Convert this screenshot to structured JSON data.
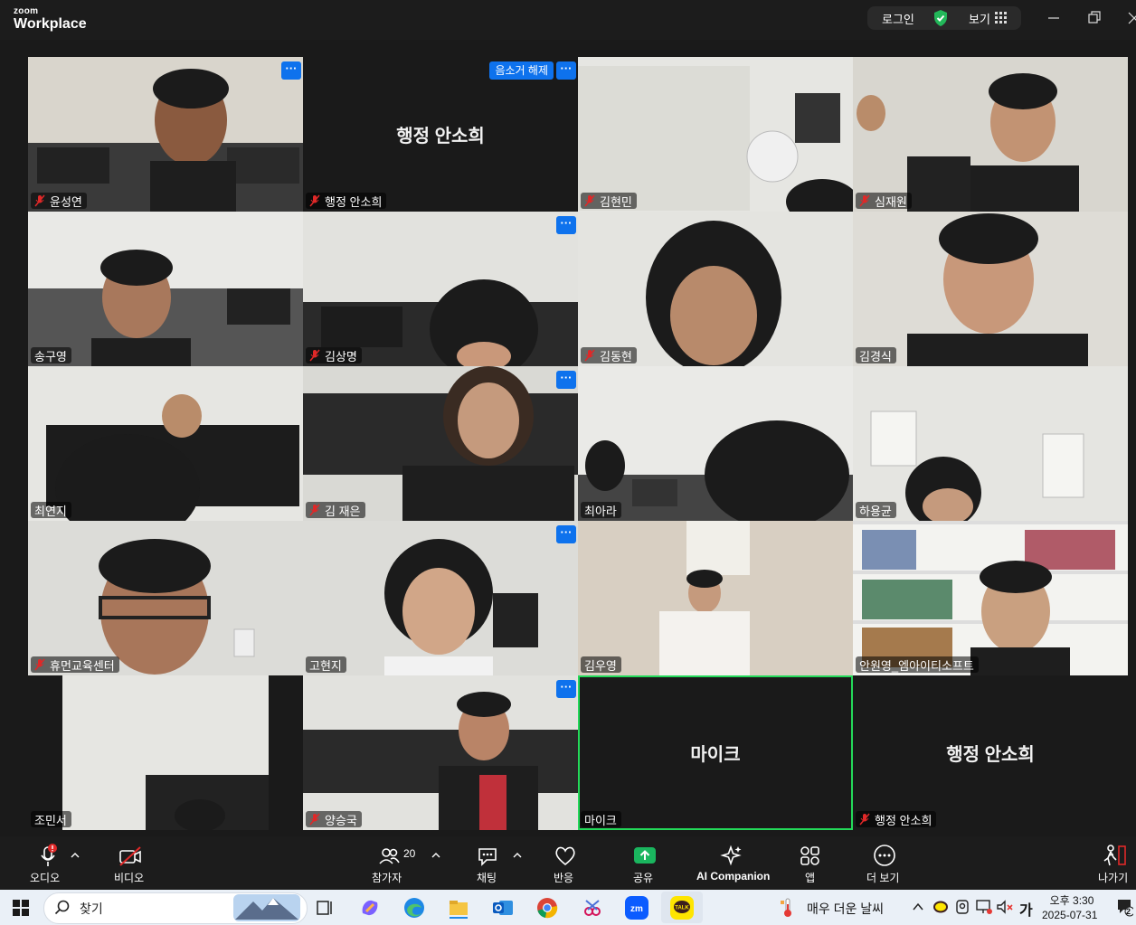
{
  "app": {
    "brand_small": "zoom",
    "brand": "Workplace"
  },
  "titlebar": {
    "login": "로그인",
    "view": "보기"
  },
  "tiles": [
    {
      "name": "윤성연",
      "muted": true,
      "more": true
    },
    {
      "name": "행정 안소희",
      "muted": true,
      "center": "행정 안소희",
      "unmute": "음소거 해제",
      "more": true
    },
    {
      "name": "김현민",
      "muted": true
    },
    {
      "name": "심재원",
      "muted": true
    },
    {
      "name": "송구영",
      "muted": false
    },
    {
      "name": "김상명",
      "muted": true,
      "more": true
    },
    {
      "name": "김동현",
      "muted": true
    },
    {
      "name": "김경식",
      "muted": false
    },
    {
      "name": "최연지",
      "muted": false
    },
    {
      "name": "김 재은",
      "muted": true,
      "more": true
    },
    {
      "name": "최아라",
      "muted": false
    },
    {
      "name": "하용균",
      "muted": false
    },
    {
      "name": "휴먼교육센터",
      "muted": true
    },
    {
      "name": "고현지",
      "muted": false,
      "more": true
    },
    {
      "name": "김우영",
      "muted": false
    },
    {
      "name": "안원영_엠아이티소프트",
      "muted": false
    },
    {
      "name": "조민서",
      "muted": false
    },
    {
      "name": "양승국",
      "muted": true,
      "more": true
    },
    {
      "name": "마이크",
      "muted": false,
      "center": "마이크",
      "active": true
    },
    {
      "name": "행정 안소희",
      "muted": true,
      "center": "행정 안소희"
    }
  ],
  "toolbar": {
    "audio": "오디오",
    "video": "비디오",
    "participants": "참가자",
    "participants_count": "20",
    "chat": "채팅",
    "reactions": "반응",
    "share": "공유",
    "ai": "AI Companion",
    "apps": "앱",
    "more": "더 보기",
    "leave": "나가기"
  },
  "taskbar": {
    "search": "찾기",
    "weather": "매우 더운 날씨",
    "ime": "가",
    "time": "오후 3:30",
    "date": "2025-07-31",
    "notif_count": "2"
  },
  "colors": {
    "accent": "#0e72ed",
    "active_speaker": "#23d959",
    "mute": "#e02828",
    "share": "#1ab55e"
  }
}
